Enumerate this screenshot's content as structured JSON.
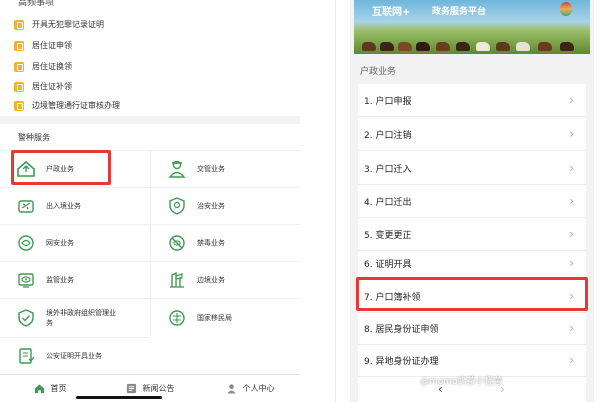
{
  "left": {
    "top_title": "高频事项",
    "hot_items": [
      "开具无犯罪记录证明",
      "居住证申领",
      "居住证换领",
      "居住证补领",
      "边境管理通行证审核办理"
    ],
    "services_title": "警种服务",
    "services": [
      {
        "label": "户政业务",
        "icon": "house-icon"
      },
      {
        "label": "交管业务",
        "icon": "traffic-police-icon"
      },
      {
        "label": "出入境业务",
        "icon": "plane-icon"
      },
      {
        "label": "治安业务",
        "icon": "shield-icon"
      },
      {
        "label": "网安业务",
        "icon": "network-icon"
      },
      {
        "label": "禁毒业务",
        "icon": "no-drugs-icon"
      },
      {
        "label": "监管业务",
        "icon": "eye-icon"
      },
      {
        "label": "边境业务",
        "icon": "border-icon"
      },
      {
        "label": "境外非政府组织管理业务",
        "icon": "check-shield-icon"
      },
      {
        "label": "国家移民局",
        "icon": "immigration-icon"
      },
      {
        "label": "公安证明开具业务",
        "icon": "certificate-icon"
      }
    ],
    "tabs": [
      {
        "label": "首页",
        "icon": "home-icon"
      },
      {
        "label": "新闻公告",
        "icon": "news-icon"
      },
      {
        "label": "个人中心",
        "icon": "user-icon"
      }
    ]
  },
  "right": {
    "banner_title": "互联网+",
    "banner_subtitle": "政务服务平台",
    "section_title": "户政业务",
    "items": [
      "1. 户口申报",
      "2. 户口注销",
      "3. 户口迁入",
      "4. 户口迁出",
      "5. 变更更正",
      "6. 证明开具",
      "7. 户口簿补领",
      "8. 居民身份证申领",
      "9. 异地身份证办理"
    ],
    "watermark": "@momo奶茶小怪兽"
  },
  "colors": {
    "accent_green": "#3f9a55",
    "highlight_red": "#e53935",
    "hot_icon": "#f0b232"
  }
}
